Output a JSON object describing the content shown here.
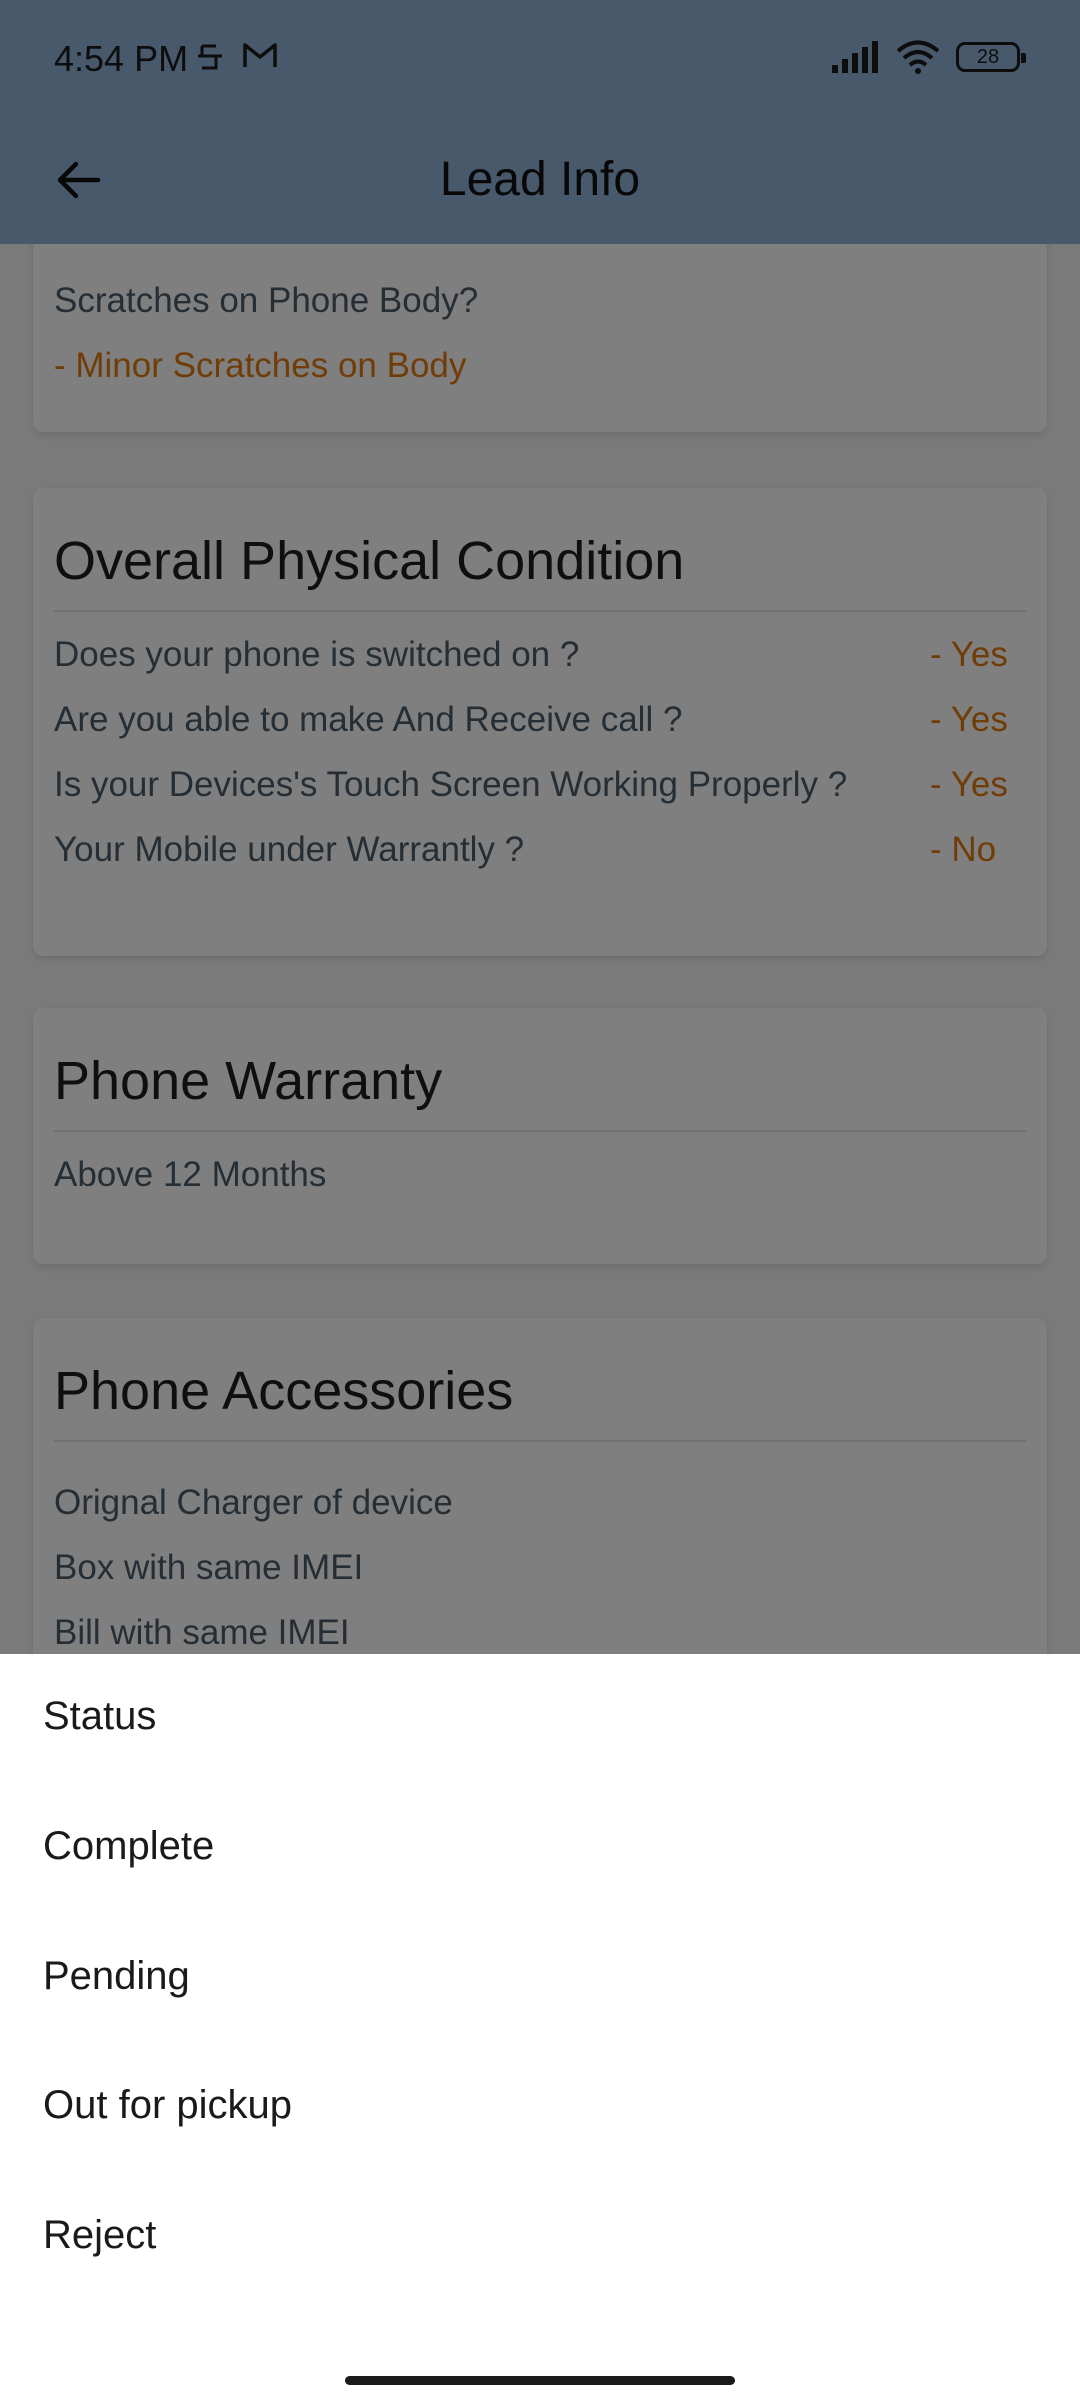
{
  "status_bar": {
    "time": "4:54 PM",
    "battery": "28",
    "icons": [
      "sim-icon",
      "gmail-icon",
      "signal-icon",
      "wifi-icon",
      "battery-icon"
    ]
  },
  "app_bar": {
    "title": "Lead Info",
    "back_icon": "arrow-left-icon",
    "color": "#8fb2d6"
  },
  "cards": {
    "scratches": {
      "question": "Scratches on Phone Body?",
      "answer": "- Minor Scratches on Body"
    },
    "overall": {
      "title": "Overall Physical Condition",
      "rows": [
        {
          "q": "Does your phone is switched on ?",
          "a": "- Yes"
        },
        {
          "q": "Are you able to make And Receive call ?",
          "a": "- Yes"
        },
        {
          "q": "Is your Devices's Touch Screen Working Properly ?",
          "a": "- Yes"
        },
        {
          "q": "Your Mobile under Warrantly ?",
          "a": "- No"
        }
      ]
    },
    "warranty": {
      "title": "Phone Warranty",
      "value": "Above 12 Months"
    },
    "accessories": {
      "title": "Phone Accessories",
      "items": [
        "Orignal Charger of device",
        "Box with same IMEI",
        "Bill with same IMEI"
      ]
    }
  },
  "status_sheet": {
    "title": "Status",
    "options": [
      "Complete",
      "Pending",
      "Out for pickup",
      "Reject"
    ]
  },
  "colors": {
    "accent_orange": "#e07a10",
    "question_text": "#4a5a6a"
  }
}
